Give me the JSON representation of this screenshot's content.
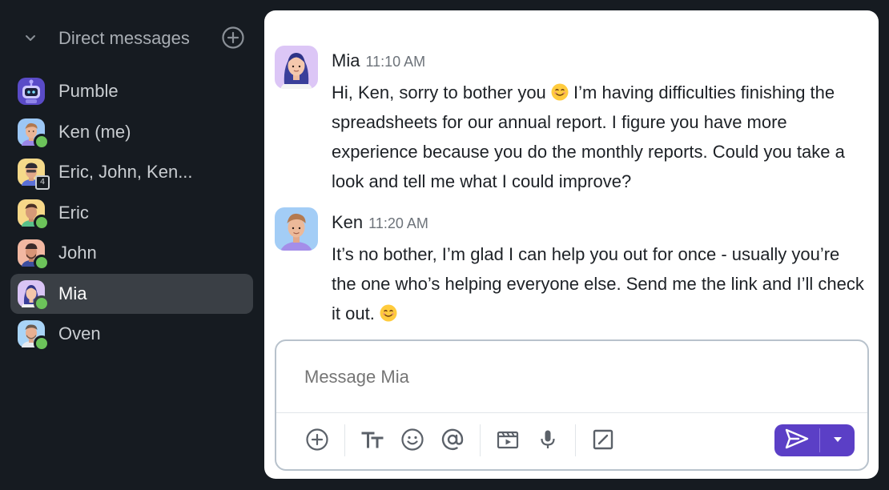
{
  "sidebar": {
    "section_title": "Direct messages",
    "items": [
      {
        "label": "Pumble",
        "status": "bot"
      },
      {
        "label": "Ken (me)",
        "status": "online"
      },
      {
        "label": "Eric, John, Ken...",
        "status": "group",
        "count": "4"
      },
      {
        "label": "Eric",
        "status": "online"
      },
      {
        "label": "John",
        "status": "online"
      },
      {
        "label": "Mia",
        "status": "online",
        "selected": true
      },
      {
        "label": "Oven",
        "status": "online"
      }
    ]
  },
  "messages": [
    {
      "author": "Mia",
      "time": "11:10 AM",
      "text_before_emoji": "Hi, Ken, sorry to bother you ",
      "text_after_emoji": " I’m having difficulties finishing the spreadsheets for our annual report. I figure you have more experience because you do the monthly reports. Could you take a look and tell me what I could improve?"
    },
    {
      "author": "Ken",
      "time": "11:20 AM",
      "text_before_emoji": "It’s no bother, I’m glad I can help you out for once - usually you’re the one who’s helping everyone else. Send me the link and I’ll check it out. ",
      "text_after_emoji": ""
    }
  ],
  "composer": {
    "placeholder": "Message Mia",
    "toolbar_icons": [
      "plus-icon",
      "text-format-icon",
      "emoji-icon",
      "mention-icon",
      "video-icon",
      "microphone-icon",
      "slash-command-icon"
    ],
    "send_icon": "send-icon",
    "send_options_icon": "chevron-down-icon"
  },
  "colors": {
    "sidebar_bg": "#161b21",
    "selected_bg": "#3a3f45",
    "online": "#6cc35a",
    "accent": "#5b3fc6"
  }
}
